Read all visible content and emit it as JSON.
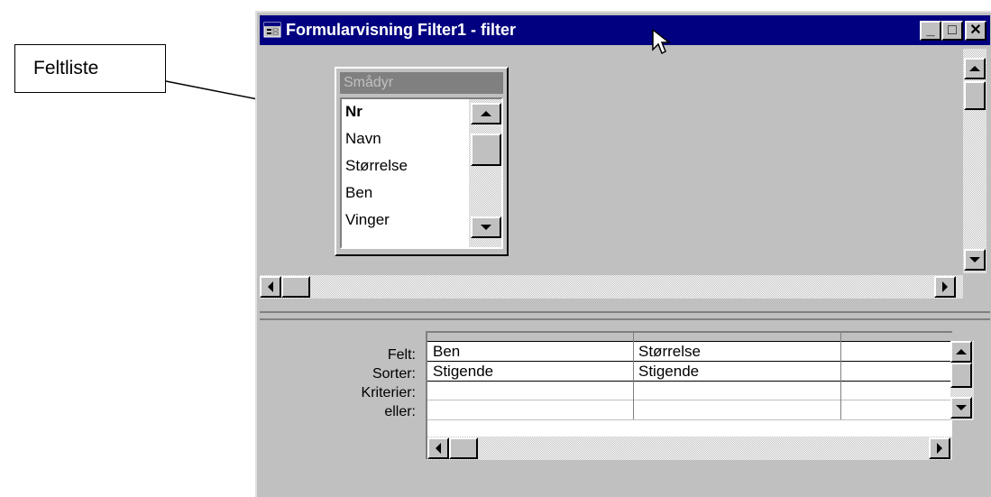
{
  "callout": {
    "label": "Feltliste"
  },
  "window": {
    "title": "Formularvisning Filter1 - filter",
    "controls": {
      "minimize": "_",
      "maximize": "□",
      "close": "✕"
    }
  },
  "field_list": {
    "title": "Smådyr",
    "items": [
      "Nr",
      "Navn",
      "Størrelse",
      "Ben",
      "Vinger"
    ]
  },
  "grid": {
    "row_labels": [
      "Felt:",
      "Sorter:",
      "Kriterier:",
      "eller:"
    ],
    "columns": [
      {
        "felt": "Ben",
        "sorter": "Stigende"
      },
      {
        "felt": "Størrelse",
        "sorter": "Stigende"
      }
    ]
  },
  "icons": [
    "form-icon",
    "mouse-cursor-icon",
    "scroll-up-icon",
    "scroll-down-icon",
    "scroll-left-icon",
    "scroll-right-icon"
  ],
  "colors": {
    "titlebar": "#000080",
    "face": "#c0c0c0",
    "field_list_header": "#808080"
  }
}
